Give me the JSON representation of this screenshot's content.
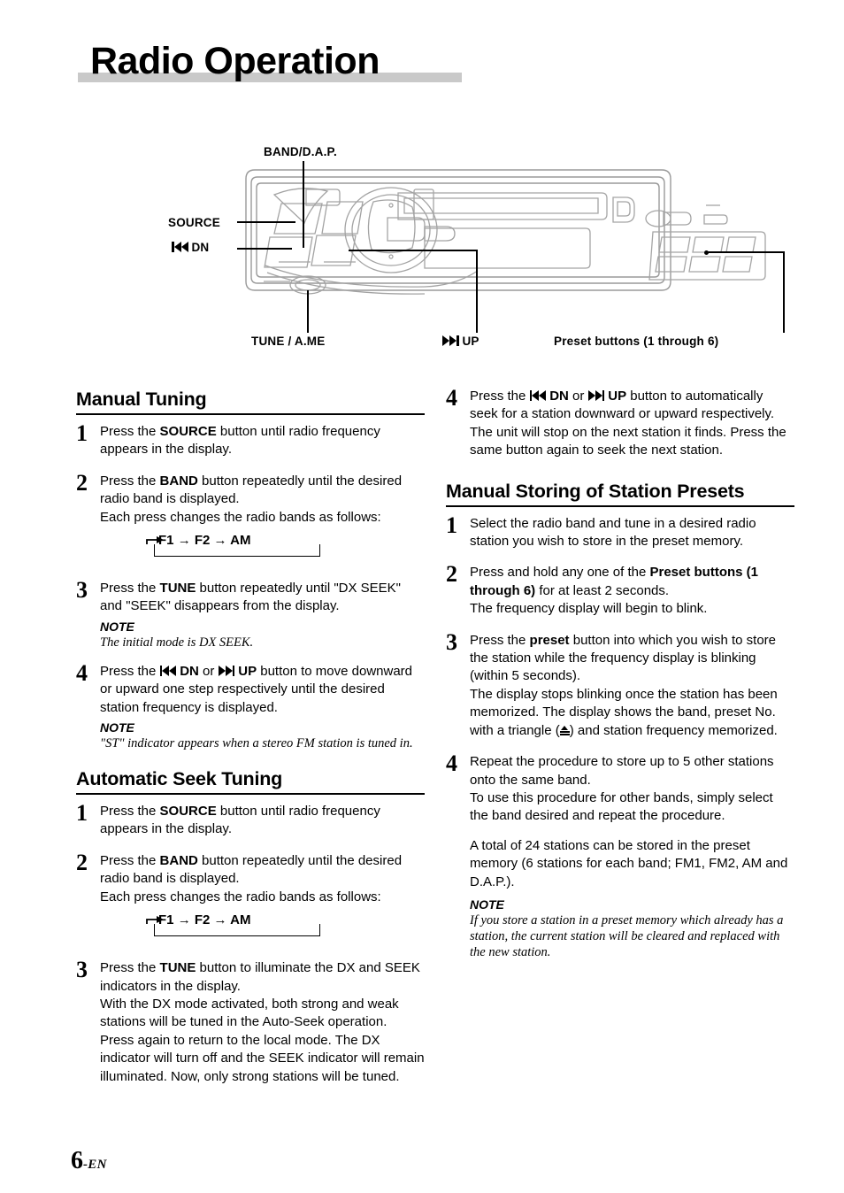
{
  "page": {
    "title": "Radio Operation",
    "page_number_main": "6",
    "page_number_suffix": "-EN"
  },
  "figure": {
    "callouts": [
      {
        "name": "band-dap",
        "label": "BAND/D.A.P."
      },
      {
        "name": "source",
        "label": "SOURCE"
      },
      {
        "name": "dn",
        "label": "DN"
      },
      {
        "name": "tune-ame",
        "label": "TUNE / A.ME"
      },
      {
        "name": "up",
        "label": "UP"
      },
      {
        "name": "preset-buttons",
        "label": "Preset buttons (1 through 6)"
      }
    ]
  },
  "band_cycle": {
    "bands": "F1",
    "band2": "F2",
    "band3": "AM",
    "arrow": "→"
  },
  "sections": {
    "manual_tuning": {
      "heading": "Manual Tuning",
      "step1": {
        "num": "1",
        "line1_a": "Press the ",
        "line1_b": "SOURCE",
        "line1_c": " button until radio frequency appears in the display."
      },
      "step2": {
        "num": "2",
        "line1_a": "Press the ",
        "line1_b": "BAND",
        "line1_c": " button repeatedly until the desired radio band is displayed.",
        "line2": "Each press changes the radio bands as follows:"
      },
      "step3": {
        "num": "3",
        "line1_a": "Press the ",
        "line1_b": "TUNE",
        "line1_c": " button repeatedly until \"DX SEEK\" and \"SEEK\" disappears from the display.",
        "note_head": "NOTE",
        "note_body": "The initial mode is DX SEEK."
      },
      "step4": {
        "num": "4",
        "a": "Press the ",
        "dn": "DN",
        "b": " or ",
        "up": "UP",
        "c": " button to move downward or upward one step respectively until the desired station frequency is displayed.",
        "note_head": "NOTE",
        "note_body": "\"ST\" indicator appears when a stereo FM station is tuned in."
      }
    },
    "automatic_seek": {
      "heading": "Automatic Seek Tuning",
      "step1": {
        "num": "1",
        "line1_a": "Press the ",
        "line1_b": "SOURCE",
        "line1_c": " button until radio frequency appears in the display."
      },
      "step2": {
        "num": "2",
        "line1_a": "Press the ",
        "line1_b": "BAND",
        "line1_c": " button repeatedly until the desired radio band is displayed.",
        "line2": "Each press changes the radio bands as follows:"
      },
      "step3": {
        "num": "3",
        "line1_a": "Press the ",
        "line1_b": "TUNE",
        "line1_c": " button to illuminate the DX and SEEK indicators in the display.",
        "line2": "With the DX mode activated, both strong and weak stations will be tuned in the Auto-Seek operation.",
        "line3": "Press again to return to the local mode. The DX indicator will turn off and the SEEK indicator will remain illuminated. Now, only strong stations will be tuned."
      },
      "step4": {
        "num": "4",
        "a": "Press the ",
        "dn": "DN",
        "b": " or ",
        "up": "UP",
        "c": " button to automatically seek for a station downward or upward respectively.",
        "line2": "The unit will stop on the next station it finds. Press the same button again to seek the next station."
      }
    },
    "manual_storing": {
      "heading": "Manual Storing of Station Presets",
      "step1": {
        "num": "1",
        "line1": "Select the radio band and tune in a desired radio station you wish to store in the preset memory."
      },
      "step2": {
        "num": "2",
        "a": "Press and hold any one of the ",
        "b": "Preset buttons (1 through 6)",
        "c": " for at least 2 seconds.",
        "line2": "The frequency display will begin to blink."
      },
      "step3": {
        "num": "3",
        "a": "Press the ",
        "b": "preset",
        "c": " button into which you wish to store the station while the frequency display is blinking (within 5 seconds).",
        "line2_a": "The display stops blinking once the station has been memorized. The display shows the band, preset No. with a triangle (",
        "line2_b": ") and station frequency memorized."
      },
      "step4": {
        "num": "4",
        "line1": "Repeat the procedure to store up to 5 other stations onto the same band.",
        "line2": "To use this procedure for other bands, simply select the band desired and repeat the procedure.",
        "line3": "A total of 24 stations can be stored in the preset memory (6 stations for each band; FM1, FM2, AM and D.A.P.).",
        "note_head": "NOTE",
        "note_body": "If you store a station in a preset memory which already has a station, the current station will be cleared and replaced with the new station."
      }
    }
  }
}
